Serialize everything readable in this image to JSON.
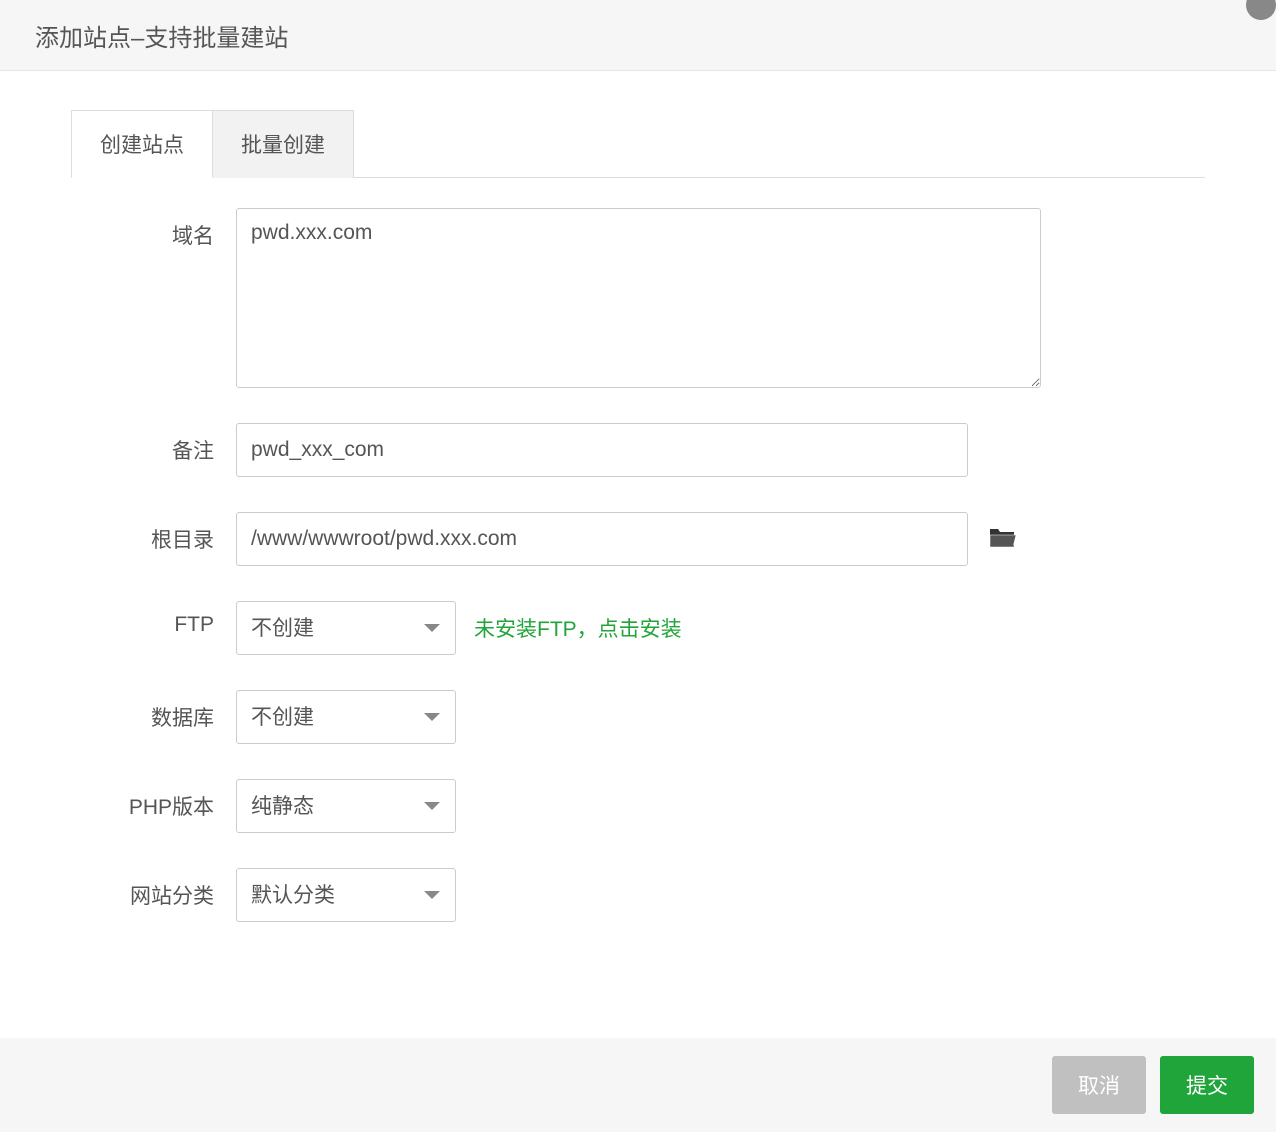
{
  "dialog": {
    "title": "添加站点–支持批量建站"
  },
  "tabs": {
    "create": "创建站点",
    "batch": "批量创建"
  },
  "form": {
    "domain": {
      "label": "域名",
      "value": "pwd.xxx.com"
    },
    "note": {
      "label": "备注",
      "value": "pwd_xxx_com"
    },
    "root": {
      "label": "根目录",
      "value": "/www/wwwroot/pwd.xxx.com"
    },
    "ftp": {
      "label": "FTP",
      "selected": "不创建",
      "hint": "未安装FTP，点击安装"
    },
    "database": {
      "label": "数据库",
      "selected": "不创建"
    },
    "php": {
      "label": "PHP版本",
      "selected": "纯静态"
    },
    "category": {
      "label": "网站分类",
      "selected": "默认分类"
    }
  },
  "buttons": {
    "cancel": "取消",
    "submit": "提交"
  }
}
